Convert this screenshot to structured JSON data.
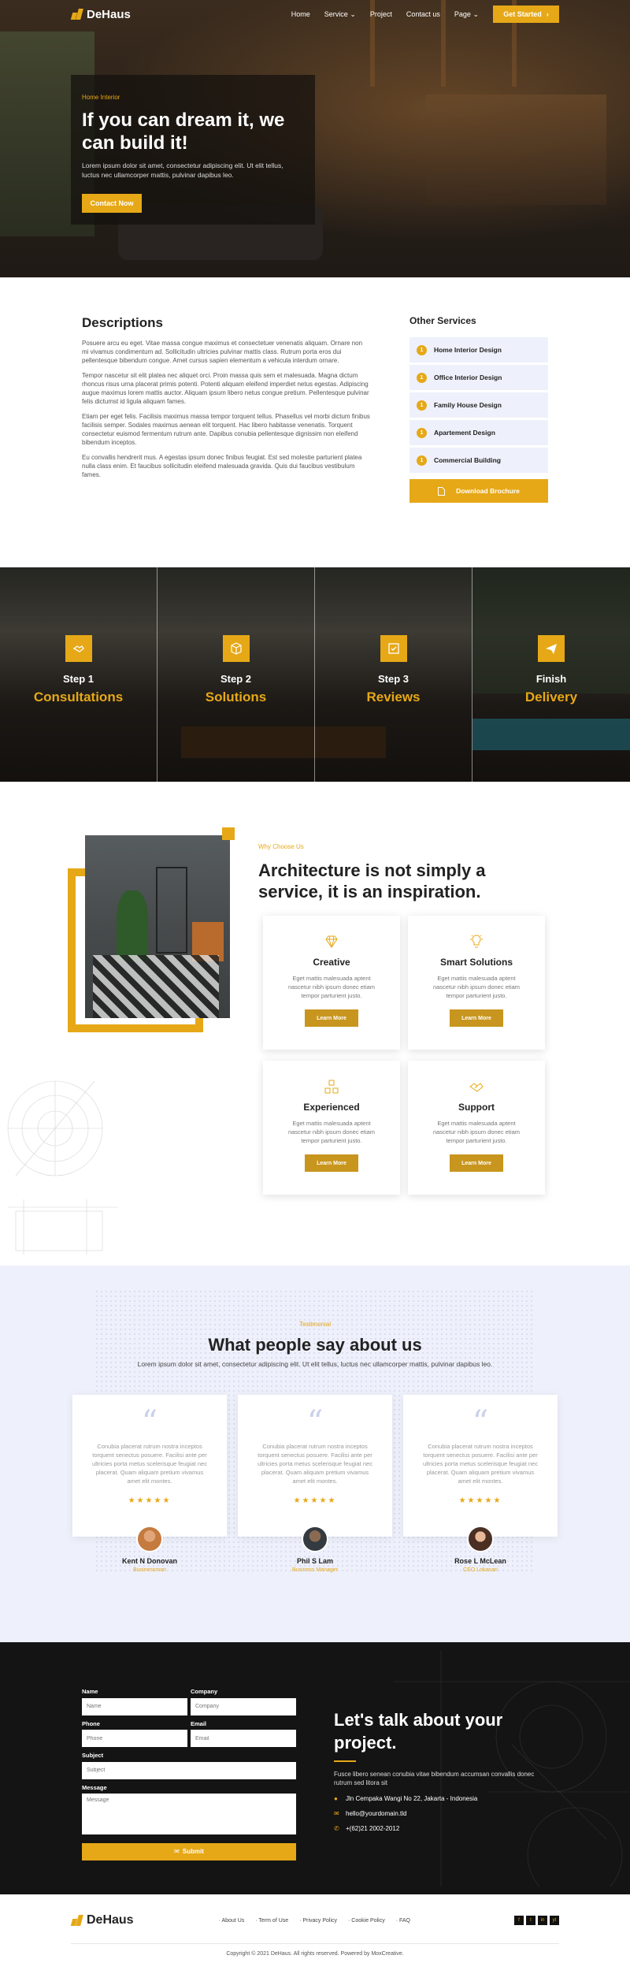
{
  "brand": {
    "name": "DeHaus",
    "accent": "#e6a817"
  },
  "nav": {
    "items": [
      "Home",
      "Service",
      "Project",
      "Contact us",
      "Page"
    ],
    "cta": "Get Started"
  },
  "hero": {
    "tag": "Home Interior",
    "title": "If you can dream it, we can build it!",
    "text": "Lorem ipsum dolor sit amet, consectetur adipiscing elit. Ut elit tellus, luctus nec ullamcorper mattis, pulvinar dapibus leo.",
    "button": "Contact Now"
  },
  "descriptions": {
    "title": "Descriptions",
    "paragraphs": [
      "Posuere arcu eu eget. Vitae massa congue maximus et consectetuer venenatis aliquam. Ornare non mi vivamus condimentum ad. Sollicitudin ultricies pulvinar mattis class. Rutrum porta eros dui pellentesque bibendum congue. Amet cursus sapien elementum a vehicula interdum ornare.",
      "Tempor nascetur sit elit platea nec aliquet orci. Proin massa quis sem et malesuada. Magna dictum rhoncus risus urna placerat primis potenti. Potenti aliquam eleifend imperdiet netus egestas. Adipiscing augue maximus lorem mattis auctor. Aliquam ipsum libero netus congue pretium. Pellentesque pulvinar felis dictumst id ligula aliquam fames.",
      "Etiam per eget felis. Facilisis maximus massa tempor torquent tellus. Phasellus vel morbi dictum finibus facilisis semper. Sodales maximus aenean elit torquent. Hac libero habitasse venenatis. Torquent consectetur euismod fermentum rutrum ante. Dapibus conubia pellentesque dignissim non eleifend bibendum inceptos.",
      "Eu convallis hendrerit mus. A egestas ipsum donec finibus feugiat. Est sed molestie parturient platea nulla class enim. Et faucibus sollicitudin eleifend malesuada gravida. Quis dui faucibus vestibulum fames."
    ],
    "other_title": "Other Services",
    "services": [
      {
        "num": "1",
        "label": "Home Interior Design"
      },
      {
        "num": "1",
        "label": "Office Interior Design"
      },
      {
        "num": "1",
        "label": "Family House Design"
      },
      {
        "num": "1",
        "label": "Apartement Design"
      },
      {
        "num": "1",
        "label": "Commercial Building"
      }
    ],
    "download": "Download Brochure"
  },
  "steps": [
    {
      "step": "Step 1",
      "name": "Consultations",
      "icon": "handshake-icon"
    },
    {
      "step": "Step 2",
      "name": "Solutions",
      "icon": "cube-icon"
    },
    {
      "step": "Step 3",
      "name": "Reviews",
      "icon": "check-square-icon"
    },
    {
      "step": "Finish",
      "name": "Delivery",
      "icon": "paper-plane-icon"
    }
  ],
  "why": {
    "tag": "Why Choose Us",
    "title": "Architecture is not simply a service, it is an inspiration.",
    "cards": [
      {
        "title": "Creative",
        "text": "Eget mattis malesuada aptent nascetur nibh ipsum donec etiam tempor parturient justo.",
        "button": "Learn More",
        "icon": "diamond-icon"
      },
      {
        "title": "Smart Solutions",
        "text": "Eget mattis malesuada aptent nascetur nibh ipsum donec etiam tempor parturient justo.",
        "button": "Learn More",
        "icon": "lightbulb-icon"
      },
      {
        "title": "Experienced",
        "text": "Eget mattis malesuada aptent nascetur nibh ipsum donec etiam tempor parturient justo.",
        "button": "Learn More",
        "icon": "boxes-icon"
      },
      {
        "title": "Support",
        "text": "Eget mattis malesuada aptent nascetur nibh ipsum donec etiam tempor parturient justo.",
        "button": "Learn More",
        "icon": "handshake-icon"
      }
    ]
  },
  "testimonial": {
    "tag": "Testimonial",
    "title": "What people say about us",
    "subtitle": "Lorem ipsum dolor sit amet, consectetur adipiscing elit. Ut elit tellus, luctus nec ullamcorper mattis, pulvinar dapibus leo.",
    "items": [
      {
        "text": "Conubia placerat rutrum nostra inceptos torquent senectus posuere. Facilisi ante per ultricies porta metus scelerisque feugiat nec placerat. Quam aliquam pretium vivamus amet elit montes.",
        "stars": "★★★★★",
        "name": "Kent N Donovan",
        "role": "Businessman"
      },
      {
        "text": "Conubia placerat rutrum nostra inceptos torquent senectus posuere. Facilisi ante per ultricies porta metus scelerisque feugiat nec placerat. Quam aliquam pretium vivamus amet elit montes.",
        "stars": "★★★★★",
        "name": "Phil S Lam",
        "role": "Business Manager"
      },
      {
        "text": "Conubia placerat rutrum nostra inceptos torquent senectus posuere. Facilisi ante per ultricies porta metus scelerisque feugiat nec placerat. Quam aliquam pretium vivamus amet elit montes.",
        "stars": "★★★★★",
        "name": "Rose L McLean",
        "role": "CEO Lokanari"
      }
    ]
  },
  "contact": {
    "labels": {
      "name": "Name",
      "company": "Company",
      "phone": "Phone",
      "email": "Email",
      "subject": "Subject",
      "message": "Message"
    },
    "placeholders": {
      "name": "Name",
      "company": "Company",
      "phone": "Phone",
      "email": "Email",
      "subject": "Subject",
      "message": "Message"
    },
    "submit": "Submit",
    "title": "Let's talk about your project.",
    "text": "Fusce libero senean conubia vitae bibendum accumsan convallis donec rutrum sed litora sit",
    "address": "Jln Cempaka Wangi No 22, Jakarta - Indonesia",
    "email": "hello@yourdomain.tld",
    "phone": "+(62)21 2002-2012"
  },
  "footer": {
    "links": [
      "About Us",
      "Term of Use",
      "Privacy Policy",
      "Cookie Policy",
      "FAQ"
    ],
    "social": [
      "f",
      "t",
      "in",
      "yt"
    ],
    "copyright": "Copyright © 2021 DeHaus. All rights reserved. Powered by MoxCreative."
  }
}
